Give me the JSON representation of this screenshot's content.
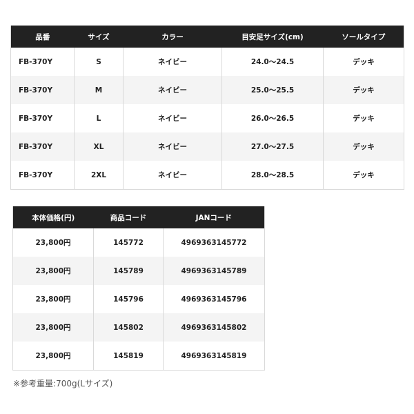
{
  "spec_table": {
    "headers": [
      "品番",
      "サイズ",
      "カラー",
      "目安足サイズ(cm)",
      "ソールタイプ"
    ],
    "rows": [
      [
        "FB-370Y",
        "S",
        "ネイビー",
        "24.0〜24.5",
        "デッキ"
      ],
      [
        "FB-370Y",
        "M",
        "ネイビー",
        "25.0〜25.5",
        "デッキ"
      ],
      [
        "FB-370Y",
        "L",
        "ネイビー",
        "26.0〜26.5",
        "デッキ"
      ],
      [
        "FB-370Y",
        "XL",
        "ネイビー",
        "27.0〜27.5",
        "デッキ"
      ],
      [
        "FB-370Y",
        "2XL",
        "ネイビー",
        "28.0〜28.5",
        "デッキ"
      ]
    ]
  },
  "price_table": {
    "headers": [
      "本体価格(円)",
      "商品コード",
      "JANコード"
    ],
    "rows": [
      [
        "23,800円",
        "145772",
        "4969363145772"
      ],
      [
        "23,800円",
        "145789",
        "4969363145789"
      ],
      [
        "23,800円",
        "145796",
        "4969363145796"
      ],
      [
        "23,800円",
        "145802",
        "4969363145802"
      ],
      [
        "23,800円",
        "145819",
        "4969363145819"
      ]
    ]
  },
  "note": "※参考重量:700g(Lサイズ)",
  "colors": {
    "header_bg": "#222222",
    "header_text": "#ffffff",
    "stripe_bg": "#f4f4f4",
    "border": "#d9d9d9"
  }
}
